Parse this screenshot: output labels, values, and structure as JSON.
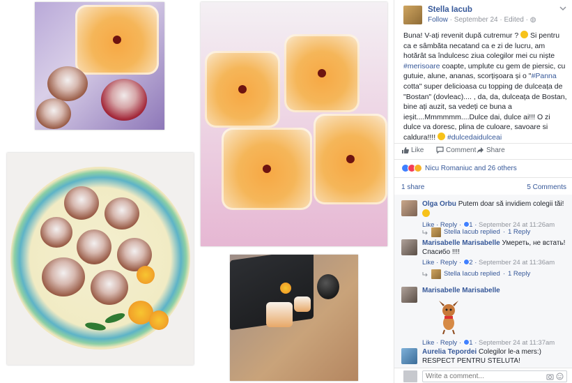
{
  "post": {
    "author": "Stella Iacub",
    "follow": "Follow",
    "date": "September 24",
    "edited": "Edited",
    "text_1": "Buna! V-ați revenit după cutremur ?",
    "text_2": " Si pentru ca e sâmbăta necatand ca e zi de lucru, am hotărât sa îndulcesc ziua colegilor mei cu niște ",
    "hashtag_1": "#merisoare",
    "text_3": " coapte, umplute cu gem de piersic, cu gutuie, alune, ananas, scorțișoara și o \"",
    "hashtag_2": "#Panna",
    "text_4": " cotta\" super delicioasa cu topping de dulceața de \"Bostan\" (dovleac).... , da, da, dulceața de Bostan, bine ați auzit, sa vedeți ce buna a ieșit....Mmmmmm....Dulce dai, dulce ai!!! O zi dulce va doresc, plina de culoare, savoare si caldura!!!!",
    "hashtag_3": "#dulcedaidulceai"
  },
  "actions": {
    "like": "Like",
    "comment": "Comment",
    "share": "Share"
  },
  "reactions": {
    "text": "Nicu Romaniuc and 26 others"
  },
  "shares_label": "1 share",
  "comments_count": "5 Comments",
  "comments": [
    {
      "author": "Olga Orbu",
      "text": "Putem doar să invidiem colegii tăi!",
      "like": "Like",
      "reply": "Reply",
      "reactions": "1",
      "time": "September 24 at 11:26am",
      "reply_author": "Stella Iacub replied",
      "reply_count": "1 Reply"
    },
    {
      "author": "Marisabelle Marisabelle",
      "text": "Умереть, не встать! Спасибо !!!!",
      "like": "Like",
      "reply": "Reply",
      "reactions": "2",
      "time": "September 24 at 11:36am",
      "reply_author": "Stella Iacub replied",
      "reply_count": "1 Reply"
    },
    {
      "author": "Marisabelle Marisabelle",
      "like": "Like",
      "reply": "Reply",
      "reactions": "1",
      "time": "September 24 at 11:37am"
    },
    {
      "author": "Aurelia Tepordei",
      "text": "Colegilor le-a mers:) RESPECT PENTRU STELUTA!"
    }
  ],
  "write_comment": {
    "placeholder": "Write a comment..."
  },
  "colors": {
    "link": "#365899",
    "meta": "#90949c",
    "comments_bg": "#f6f7f9"
  }
}
